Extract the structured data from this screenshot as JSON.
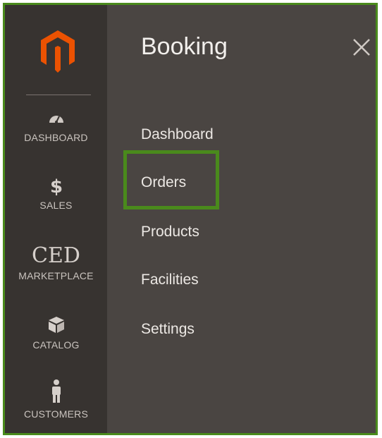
{
  "sidebar": {
    "logo_icon": "magento-logo-icon",
    "items": [
      {
        "label": "DASHBOARD",
        "icon": "speedometer-icon"
      },
      {
        "label": "SALES",
        "icon": "dollar-icon"
      },
      {
        "label": "MARKETPLACE",
        "brand_text": "CED"
      },
      {
        "label": "CATALOG",
        "icon": "box-icon"
      },
      {
        "label": "CUSTOMERS",
        "icon": "person-icon"
      }
    ]
  },
  "panel": {
    "title": "Booking",
    "close_icon": "close-icon",
    "links": [
      {
        "label": "Dashboard"
      },
      {
        "label": "Orders"
      },
      {
        "label": "Products"
      },
      {
        "label": "Facilities"
      },
      {
        "label": "Settings"
      }
    ]
  },
  "colors": {
    "frame_border": "#4a8a1c",
    "sidebar_bg": "#373330",
    "panel_bg": "#4a4542",
    "logo_orange": "#eb5202"
  }
}
